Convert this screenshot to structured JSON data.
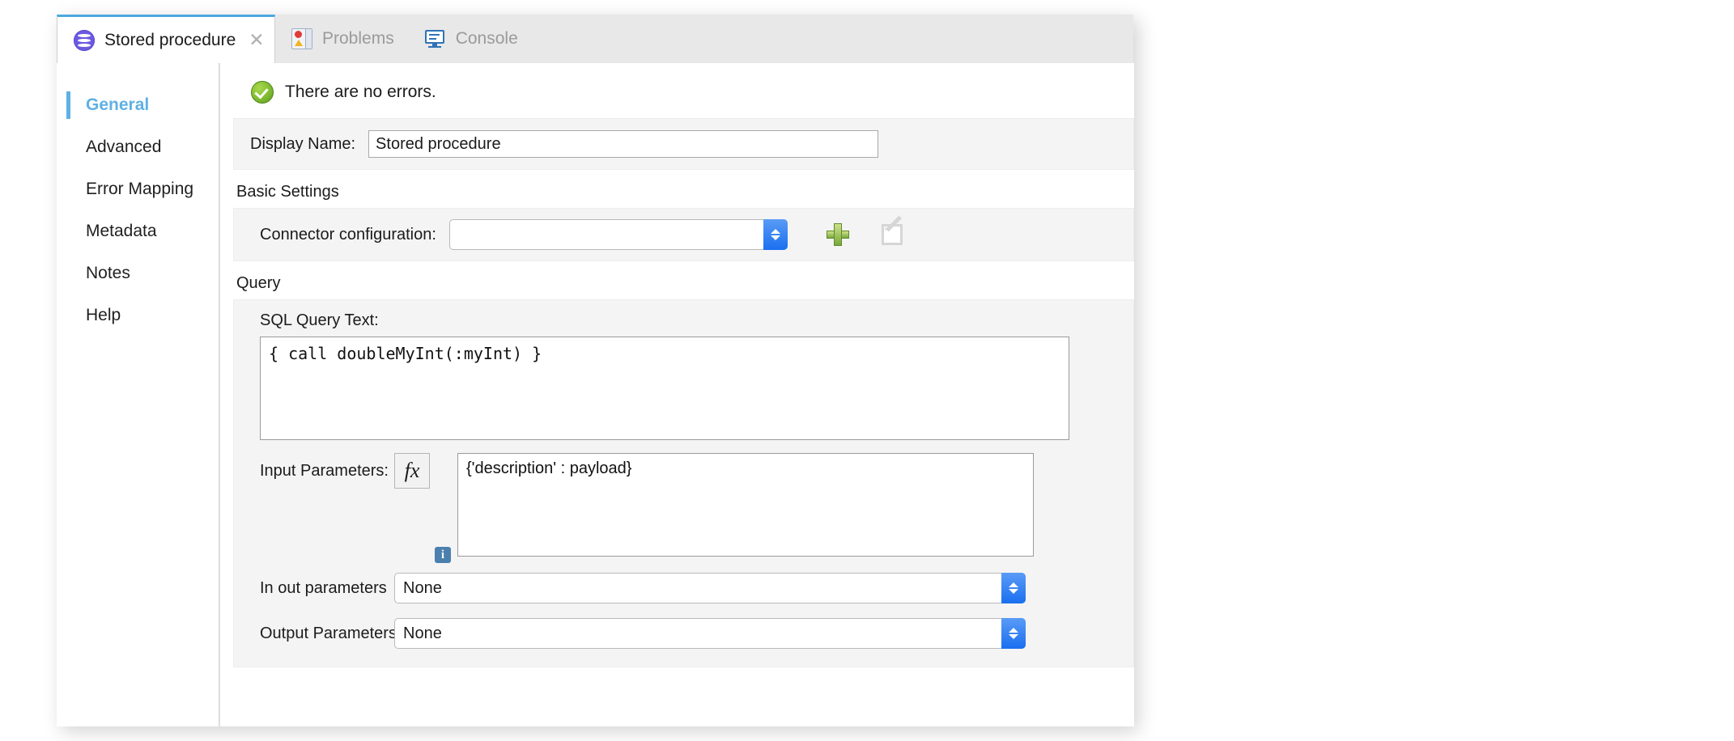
{
  "window": {
    "tabs": [
      {
        "label": "Stored procedure",
        "icon": "database-icon",
        "active": true,
        "closable": true
      },
      {
        "label": "Problems",
        "icon": "problems-icon",
        "active": false,
        "closable": false
      },
      {
        "label": "Console",
        "icon": "console-icon",
        "active": false,
        "closable": false
      }
    ],
    "accent_color": "#4aa8e0"
  },
  "sidebar": {
    "items": [
      {
        "label": "General",
        "active": true
      },
      {
        "label": "Advanced",
        "active": false
      },
      {
        "label": "Error Mapping",
        "active": false
      },
      {
        "label": "Metadata",
        "active": false
      },
      {
        "label": "Notes",
        "active": false
      },
      {
        "label": "Help",
        "active": false
      }
    ],
    "active_color": "#5fb0e5"
  },
  "status": {
    "icon": "check-circle-icon",
    "text": "There are no errors.",
    "color": "#7cb82f"
  },
  "general": {
    "display_name_label": "Display Name:",
    "display_name_value": "Stored procedure",
    "display_name_placeholder": ""
  },
  "basic_settings": {
    "title": "Basic Settings",
    "connector_label": "Connector configuration:",
    "connector_value": "",
    "connector_placeholder": "",
    "add_button_name": "add-configuration",
    "edit_button_name": "edit-configuration"
  },
  "query": {
    "title": "Query",
    "sql_label": "SQL Query Text:",
    "sql_value": "{ call doubleMyInt(:myInt) }",
    "input_params_label": "Input Parameters:",
    "fx_label": "fx",
    "input_params_value": "{'description' : payload}",
    "info_label": "i",
    "in_out_label": "In out parameters",
    "in_out_value": "None",
    "output_label": "Output Parameters",
    "output_value": "None"
  }
}
